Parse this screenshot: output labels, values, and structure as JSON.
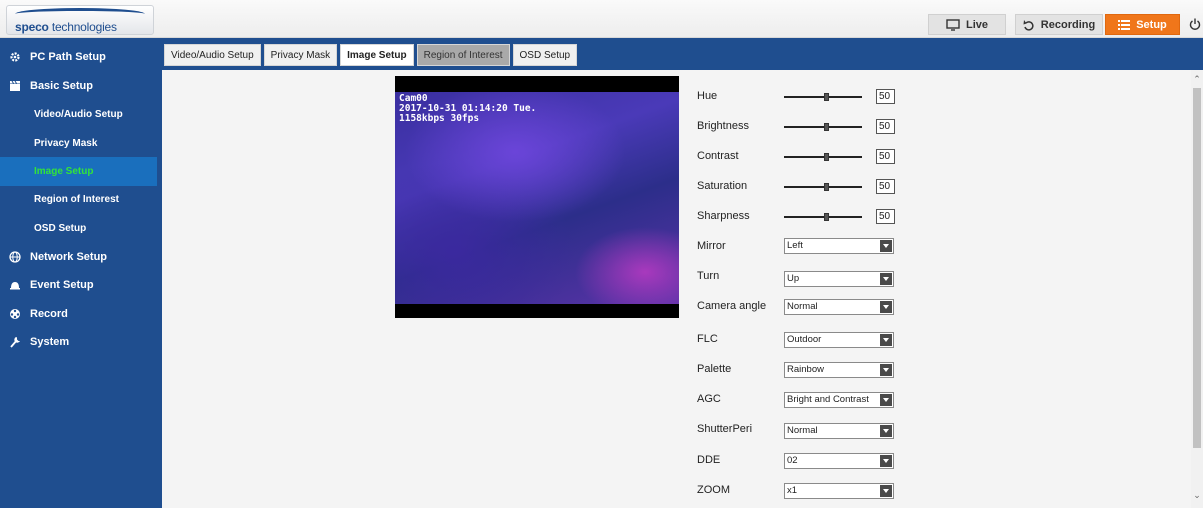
{
  "brand": {
    "name_bold": "speco",
    "name_thin": " technologies"
  },
  "topnav": {
    "live": "Live",
    "recording": "Recording",
    "setup": "Setup"
  },
  "sidebar": {
    "pc_path": "PC Path Setup",
    "basic": "Basic Setup",
    "subs": [
      "Video/Audio Setup",
      "Privacy Mask",
      "Image Setup",
      "Region of Interest",
      "OSD Setup"
    ],
    "network": "Network Setup",
    "event": "Event Setup",
    "record": "Record",
    "system": "System"
  },
  "tabs": [
    "Video/Audio Setup",
    "Privacy Mask",
    "Image Setup",
    "Region of Interest",
    "OSD Setup"
  ],
  "video": {
    "osd": "Cam00\n2017-10-31 01:14:20 Tue.\n1158kbps 30fps"
  },
  "sliders": [
    {
      "label": "Hue",
      "value": "50"
    },
    {
      "label": "Brightness",
      "value": "50"
    },
    {
      "label": "Contrast",
      "value": "50"
    },
    {
      "label": "Saturation",
      "value": "50"
    },
    {
      "label": "Sharpness",
      "value": "50"
    }
  ],
  "selects": [
    {
      "label": "Mirror",
      "value": "Left"
    },
    {
      "label": "Turn",
      "value": "Up"
    },
    {
      "label": "Camera angle",
      "value": "Normal"
    },
    {
      "label": "FLC",
      "value": "Outdoor"
    },
    {
      "label": "Palette",
      "value": "Rainbow"
    },
    {
      "label": "AGC",
      "value": "Bright and Contrast"
    },
    {
      "label": "ShutterPeri",
      "value": "Normal"
    },
    {
      "label": "DDE",
      "value": "02"
    },
    {
      "label": "ZOOM",
      "value": "x1"
    }
  ],
  "colors": {
    "brand_blue": "#1f4e8f",
    "accent_orange": "#f0761a",
    "active_green": "#32e43a"
  }
}
